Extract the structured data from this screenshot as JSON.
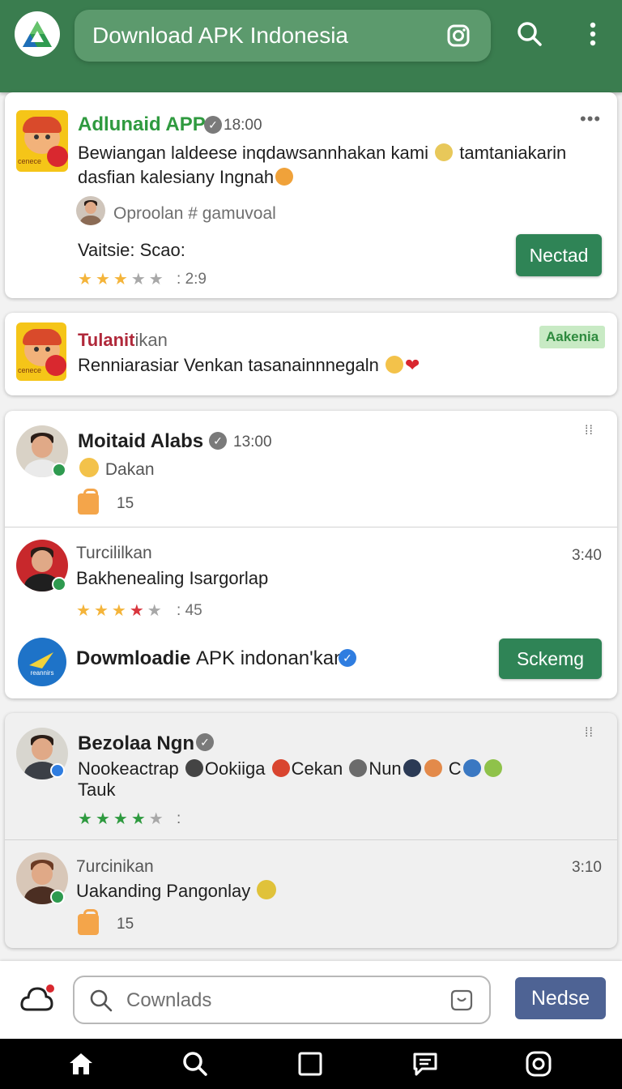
{
  "header": {
    "title": "Download APK Indonesia",
    "colors": {
      "bar": "#3a7d4f",
      "pill": "#5c9a6d"
    }
  },
  "card1": {
    "name": "Adlunaid APP",
    "time": "18:00",
    "line1": "Bewiangan laldeese inqdawsannhakan kami",
    "line1b": "tamtaniakarin",
    "line2": "dasfian kalesiany Ingnah",
    "sub": "Oproolan # gamuvoal",
    "label": "Vaitsie: Scao:",
    "rating": "2:9",
    "stars": 3,
    "button": "Nectad",
    "icon_tag": "cenece"
  },
  "card2": {
    "name": "Tulanit",
    "name_rest": "ikan",
    "badge": "Aakenia",
    "text": "Renniarasiar Venkan tasanainnnegaln",
    "icon_tag": "cenece"
  },
  "card3": {
    "post1": {
      "name": "Moitaid Alabs",
      "time": "13:00",
      "text": "Dakan",
      "count": "15"
    },
    "post2": {
      "name": "Turcililkan",
      "time": "3:40",
      "text": "Bakhenealing Isargorlap",
      "rating": "45",
      "stars": 3
    },
    "promo": {
      "name": "Dowmloadie",
      "name_rest": "APK indonan'kan",
      "button": "Sckemg",
      "icon_tag": "reannirs"
    }
  },
  "card4": {
    "post1": {
      "name": "Bezolaa Ngn",
      "line1_parts": [
        "Nookeactrap",
        "Ookiiga",
        "Cekan",
        "Nun",
        "C"
      ],
      "line2": "Tauk",
      "stars": 4
    },
    "post2": {
      "name": "7urcinikan",
      "time": "3:10",
      "text": "Uakanding Pangonlay",
      "count": "15"
    }
  },
  "composer": {
    "placeholder": "Cownlads",
    "button": "Nedse"
  },
  "nav": [
    "home-icon",
    "search-icon",
    "square-icon",
    "chat-icon",
    "camera-icon"
  ]
}
